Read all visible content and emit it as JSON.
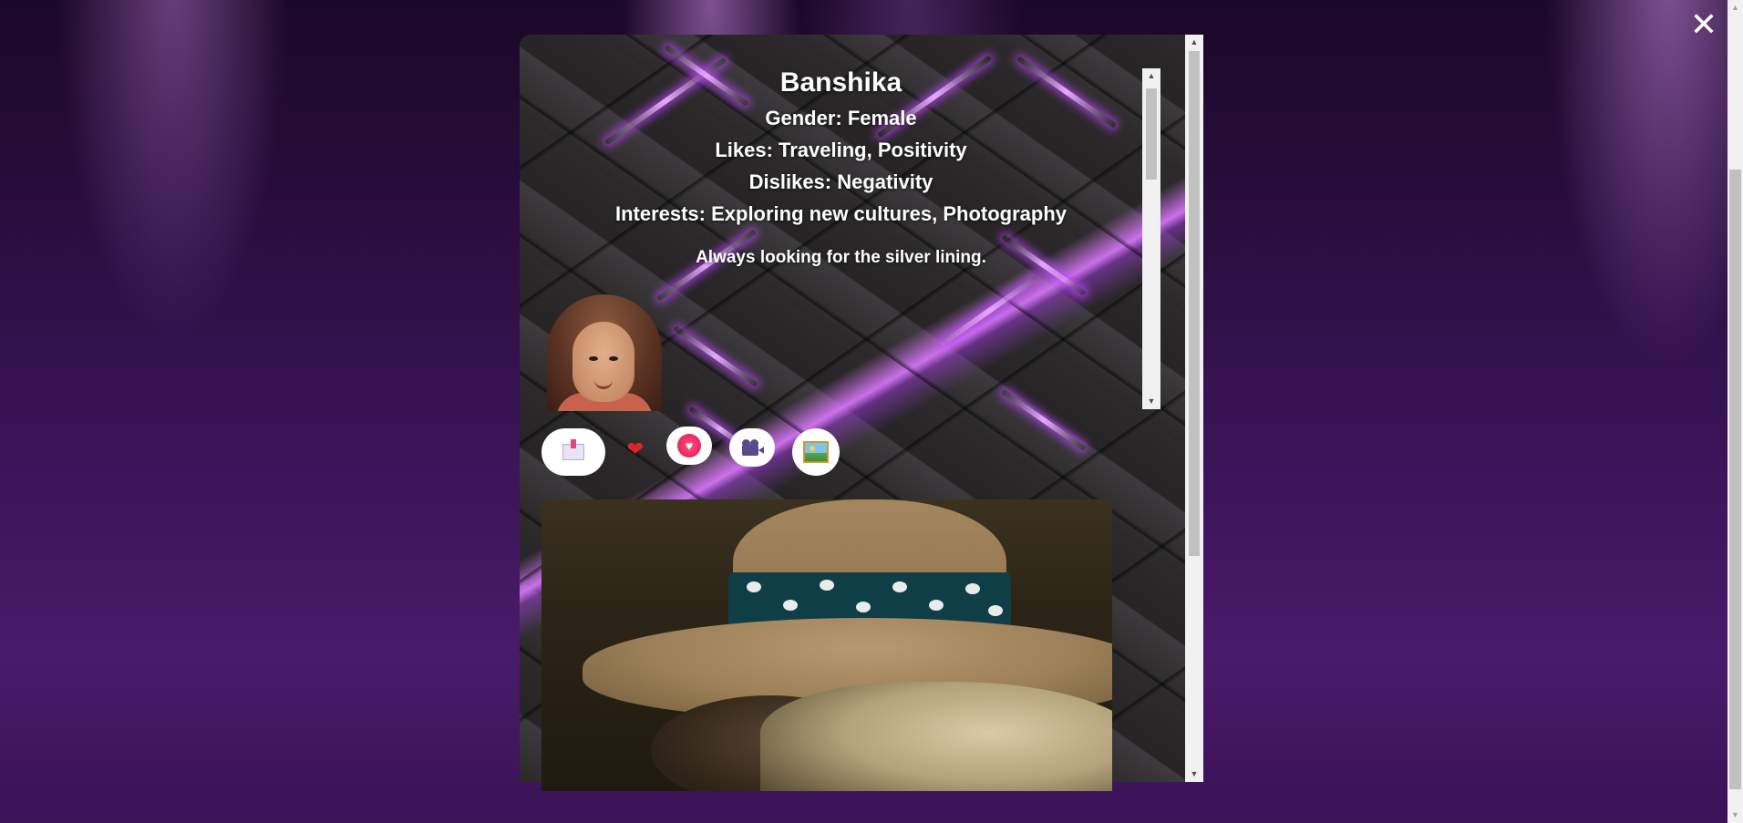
{
  "window": {
    "close_label": "✕"
  },
  "profile": {
    "name": "Banshika",
    "gender_line": "Gender: Female",
    "likes_line": "Likes: Traveling, Positivity",
    "dislikes_line": "Dislikes: Negativity",
    "interests_line": "Interests: Exploring new cultures, Photography",
    "tagline": "Always looking for the silver lining."
  },
  "actions": {
    "icons": [
      "mail-download-icon",
      "heart-icon",
      "heart-gift-icon",
      "video-camera-icon",
      "gallery-icon"
    ],
    "heart_glyph": "❤",
    "heart_gift_glyph": "♥"
  },
  "scrollbars": {
    "arrow_up": "▲",
    "arrow_down": "▼"
  },
  "colors": {
    "background": "#3b1458",
    "accent_glow": "#c850ff",
    "text": "#ffffff"
  }
}
